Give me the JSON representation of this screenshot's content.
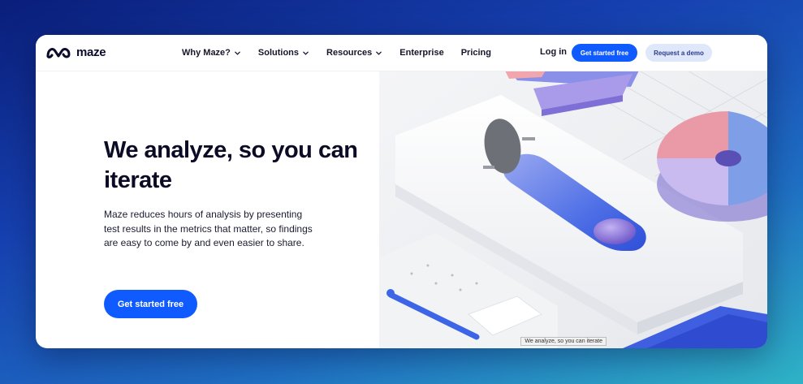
{
  "brand": {
    "name": "maze"
  },
  "nav": {
    "items": [
      {
        "label": "Why Maze?",
        "has_dropdown": true
      },
      {
        "label": "Solutions",
        "has_dropdown": true
      },
      {
        "label": "Resources",
        "has_dropdown": true
      },
      {
        "label": "Enterprise",
        "has_dropdown": false
      },
      {
        "label": "Pricing",
        "has_dropdown": false
      }
    ],
    "login": "Log in",
    "cta_primary": "Get started free",
    "cta_secondary": "Request a demo"
  },
  "hero": {
    "title": "We analyze, so you can iterate",
    "description": "Maze reduces hours of analysis by presenting test results in the metrics that matter, so findings are easy to come by and even easier to share.",
    "cta": "Get started free"
  },
  "illustration": {
    "caption": "We analyze, so you can iterate"
  },
  "colors": {
    "accent": "#0f5bff",
    "secondary_button": "#dfe8fb",
    "text_dark": "#0b0b26",
    "pie_pink": "#e99aa6",
    "pie_lavender": "#b7a6ec",
    "pie_blue": "#7f9ee8"
  },
  "icons": [
    "maze-logo-icon",
    "chevron-down-icon"
  ]
}
